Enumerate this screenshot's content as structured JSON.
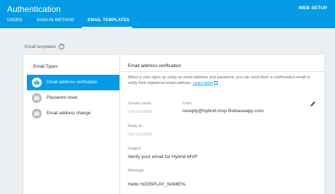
{
  "header": {
    "title": "Authentication",
    "web_setup_label": "WEB SETUP",
    "tabs": [
      {
        "label": "USERS"
      },
      {
        "label": "SIGN-IN METHOD"
      },
      {
        "label": "EMAIL TEMPLATES"
      }
    ]
  },
  "page": {
    "section_title": "Email templates",
    "help_icon": "help-circle-icon"
  },
  "sidebar": {
    "heading": "Email Types",
    "items": [
      {
        "label": "Email address verification",
        "icon": "mail-icon",
        "active": true
      },
      {
        "label": "Password reset",
        "icon": "key-icon",
        "active": false
      },
      {
        "label": "Email address change",
        "icon": "mail-change-icon",
        "active": false
      }
    ]
  },
  "content": {
    "title": "Email address verification",
    "description": "When a user signs up using an email address and password, you can send them a confirmation email to verify their registered email address.",
    "learn_more": "Learn more",
    "sender_name_label": "Sender name",
    "sender_name_value": "not provided",
    "from_label": "From",
    "from_value": "noreply@hybrid-mvp.firebaseapp.com",
    "reply_to_label": "Reply to",
    "reply_to_value": "not provided",
    "subject_label": "Subject",
    "subject_value": "Verify your email for Hybrid-MVP",
    "message_label": "Message",
    "message_value": "Hello %DISPLAY_NAME%,"
  },
  "colors": {
    "accent": "#039be5",
    "background": "#eceff1"
  }
}
